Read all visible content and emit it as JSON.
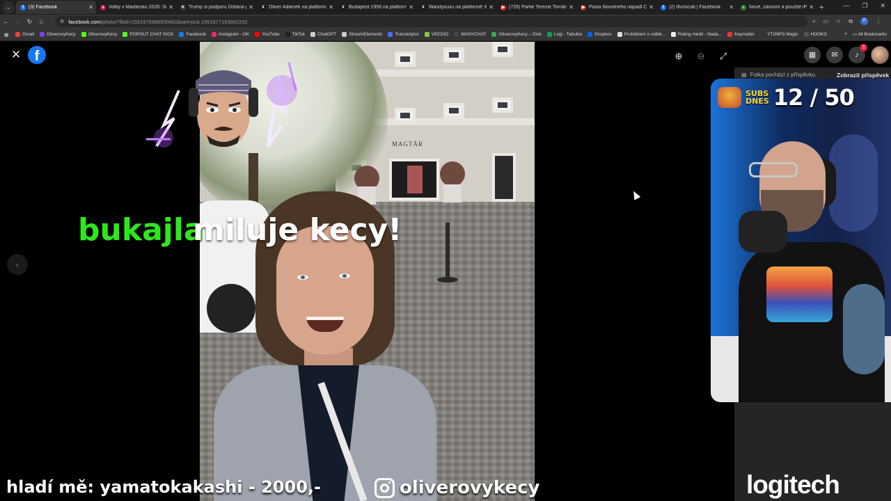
{
  "browser": {
    "tabs": [
      {
        "title": "(3) Facebook",
        "color": "#1877f2",
        "glyph": "f",
        "active": true
      },
      {
        "title": "Volby v Maďarsku 2026: Souh",
        "color": "#c2185b",
        "glyph": "s"
      },
      {
        "title": "Trump si podporu Orbána při",
        "color": "#333333",
        "glyph": "K"
      },
      {
        "title": "Oliver Adámek na platformě X",
        "color": "#111111",
        "glyph": "X"
      },
      {
        "title": "Budapest 1956 na platformě X",
        "color": "#111111",
        "glyph": "X"
      },
      {
        "title": "Wandyxuxu na platformě X: „",
        "color": "#111111",
        "glyph": "X"
      },
      {
        "title": "(726) Partie Terezie Tománkov",
        "color": "#e62117",
        "glyph": "▶"
      },
      {
        "title": "Pavla Novotného napadl Cavo",
        "color": "#c62828",
        "glyph": "▶"
      },
      {
        "title": "(2) Illumicati | Facebook",
        "color": "#1877f2",
        "glyph": "f"
      },
      {
        "title": "Nové, zánovní a použité iPho",
        "color": "#2e7d32",
        "glyph": "•"
      }
    ],
    "new_tab": "+",
    "window_controls": [
      "—",
      "❐",
      "✕"
    ],
    "url_host": "facebook.com",
    "url_path": "/photo/?fbid=1551976386935662&set=pcb.1551977153602252",
    "bookmarks": [
      {
        "label": "Gmail",
        "color": "#ea4335"
      },
      {
        "label": "OliverovyKecy",
        "color": "#7b3fe4"
      },
      {
        "label": "OliverovyKecy",
        "color": "#53fc18"
      },
      {
        "label": "POPOUT CHAT KICK",
        "color": "#53fc18"
      },
      {
        "label": "Facebook",
        "color": "#1877f2"
      },
      {
        "label": "Instagram - OK",
        "color": "#e1306c"
      },
      {
        "label": "YouTube",
        "color": "#ff0000"
      },
      {
        "label": "TikTok",
        "color": "#222222"
      },
      {
        "label": "ChatGPT",
        "color": "#cccccc"
      },
      {
        "label": "StreamElements",
        "color": "#cccccc"
      },
      {
        "label": "Transkriptor",
        "color": "#4a6cf7"
      },
      {
        "label": "VEEDIO",
        "color": "#8bc34a"
      },
      {
        "label": "MANYCHAT",
        "color": "#444444"
      },
      {
        "label": "OliverovyKecy – Disk",
        "color": "#34a853"
      },
      {
        "label": "Logi - Tabulka",
        "color": "#0f9d58"
      },
      {
        "label": "Dropbox",
        "color": "#0061ff"
      },
      {
        "label": "Prohlášení o volbě...",
        "color": "#dddddd"
      },
      {
        "label": "Rating médií - Nada...",
        "color": "#eeeeee"
      },
      {
        "label": "Keymailer",
        "color": "#e53935"
      },
      {
        "label": "YT2MP3 Magic",
        "color": "#333333"
      },
      {
        "label": "HOOKS",
        "color": "#555555"
      }
    ],
    "bookmarks_more": "»",
    "all_bookmarks": "All Bookmarks",
    "profile_initial": "P"
  },
  "viewer": {
    "prev_icon": "‹",
    "close_icon": "✕",
    "zoom_in_icon": "⊕",
    "zoom_out_icon": "⊖",
    "fullscreen_icon": "⤢",
    "photo_sign": "MAGTÁR"
  },
  "fb_header": {
    "notification_count": "3"
  },
  "sidebar": {
    "hint": "Fotka pochází z příspěvku.",
    "view_post": "Zobrazit příspěvek"
  },
  "overlays": {
    "donor_name": "bukajla",
    "donor_message": "miluje kecy!",
    "subs_label_line1": "SUBS",
    "subs_label_line2": "DNES",
    "subs_count": "12 / 50",
    "tip_text": "hladí mě: yamatokakashi - 2000,-",
    "instagram_handle": "oliverovykecy",
    "sponsor": "logitech"
  },
  "colors": {
    "donor_name": "#2ee81c",
    "facebook_blue": "#1877f2",
    "notification_red": "#e41e3f"
  }
}
